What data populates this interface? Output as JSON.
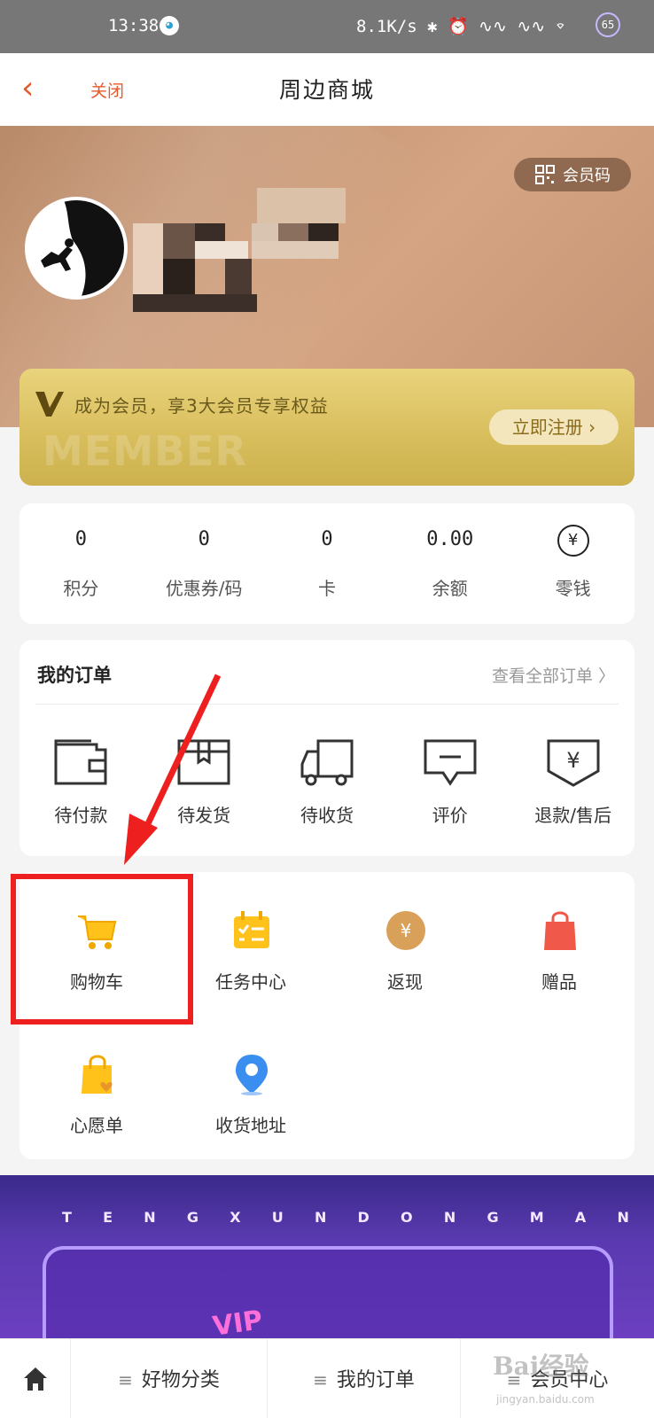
{
  "status_bar": {
    "time": "13:38",
    "speed": "8.1K/s",
    "battery": "65"
  },
  "header": {
    "close_label": "关闭",
    "title": "周边商城"
  },
  "profile": {
    "member_code_label": "会员码"
  },
  "vip_card": {
    "text": "成为会员，享3大会员专享权益",
    "bg_word": "MEMBER",
    "register_label": "立即注册 ›"
  },
  "stats": [
    {
      "value": "0",
      "label": "积分"
    },
    {
      "value": "0",
      "label": "优惠券/码"
    },
    {
      "value": "0",
      "label": "卡"
    },
    {
      "value": "0.00",
      "label": "余额"
    },
    {
      "value": "¥",
      "label": "零钱"
    }
  ],
  "orders": {
    "title": "我的订单",
    "view_all": "查看全部订单 〉",
    "items": [
      {
        "label": "待付款",
        "icon": "wallet-icon"
      },
      {
        "label": "待发货",
        "icon": "package-icon"
      },
      {
        "label": "待收货",
        "icon": "truck-icon"
      },
      {
        "label": "评价",
        "icon": "comment-icon"
      },
      {
        "label": "退款/售后",
        "icon": "refund-icon"
      }
    ]
  },
  "tools": [
    {
      "label": "购物车",
      "icon": "cart-icon"
    },
    {
      "label": "任务中心",
      "icon": "calendar-icon"
    },
    {
      "label": "返现",
      "icon": "cashback-icon"
    },
    {
      "label": "赠品",
      "icon": "gift-bag-icon"
    },
    {
      "label": "心愿单",
      "icon": "wishlist-icon"
    },
    {
      "label": "收货地址",
      "icon": "location-icon"
    }
  ],
  "promo": {
    "letters": [
      "T",
      "E",
      "N",
      "G",
      "X",
      "U",
      "N",
      "D",
      "O",
      "N",
      "G",
      "M",
      "A",
      "N"
    ],
    "badge": "VIP"
  },
  "bottom_nav": {
    "categories": "好物分类",
    "orders": "我的订单",
    "member": "会员中心"
  },
  "watermark": {
    "main": "Bai经验",
    "sub": "jingyan.baidu.com"
  },
  "colors": {
    "accent": "#e35a2c",
    "annotation": "#ee1f1f",
    "vip_gold": "#d8bd5c"
  }
}
